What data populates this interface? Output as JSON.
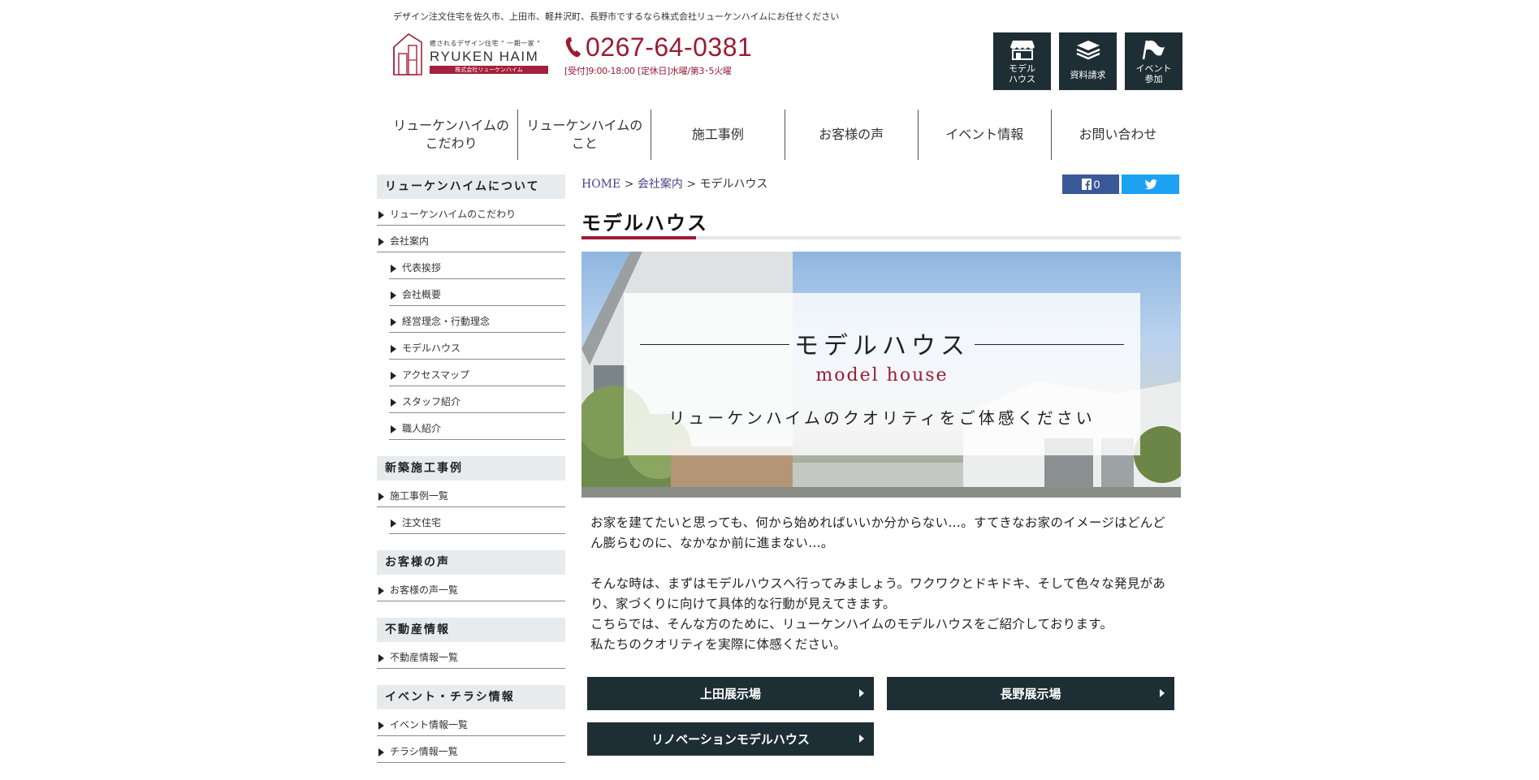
{
  "header": {
    "tagline": "デザイン注文住宅を佐久市、上田市、軽井沢町、長野市でするなら株式会社リューケンハイムにお任せください",
    "logo": {
      "catch": "癒されるデザイン住宅 \" 一期一家 \"",
      "name": "RYUKEN HAIM",
      "company": "株式会社リューケンハイム"
    },
    "phone": "0267-64-0381",
    "hours": "[受付]9:00-18:00 [定休日]水曜/第3･5火曜",
    "buttons": [
      {
        "label1": "モデル",
        "label2": "ハウス",
        "icon": "store-icon"
      },
      {
        "label1": "資料請求",
        "label2": "",
        "icon": "documents-icon"
      },
      {
        "label1": "イベント",
        "label2": "参加",
        "icon": "flag-icon"
      }
    ]
  },
  "nav": [
    {
      "line1": "リューケンハイムの",
      "line2": "こだわり"
    },
    {
      "line1": "リューケンハイムの",
      "line2": "こと"
    },
    {
      "line1": "施工事例",
      "line2": ""
    },
    {
      "line1": "お客様の声",
      "line2": ""
    },
    {
      "line1": "イベント情報",
      "line2": ""
    },
    {
      "line1": "お問い合わせ",
      "line2": ""
    }
  ],
  "sidebar": {
    "about": {
      "heading": "リューケンハイムについて",
      "items": [
        "リューケンハイムのこだわり",
        "会社案内"
      ],
      "sub_items": [
        "代表挨拶",
        "会社概要",
        "経営理念・行動理念",
        "モデルハウス",
        "アクセスマップ",
        "スタッフ紹介",
        "職人紹介"
      ]
    },
    "works": {
      "heading": "新築施工事例",
      "items": [
        "施工事例一覧"
      ],
      "sub_items": [
        "注文住宅"
      ]
    },
    "voice": {
      "heading": "お客様の声",
      "items": [
        "お客様の声一覧"
      ]
    },
    "estate": {
      "heading": "不動産情報",
      "items": [
        "不動産情報一覧"
      ]
    },
    "event": {
      "heading": "イベント・チラシ情報",
      "items": [
        "イベント情報一覧",
        "チラシ情報一覧"
      ]
    }
  },
  "breadcrumb": {
    "home": "HOME",
    "sep": ">",
    "parent": "会社案内",
    "current": "モデルハウス"
  },
  "share": {
    "fb_count": "0"
  },
  "page": {
    "title": "モデルハウス",
    "hero_title": "モデルハウス",
    "hero_sub": "model house",
    "hero_caption": "リューケンハイムのクオリティをご体感ください",
    "paragraphs": [
      "お家を建てたいと思っても、何から始めればいいか分からない…。すてきなお家のイメージはどんどん膨らむのに、なかなか前に進まない…。",
      "そんな時は、まずはモデルハウスへ行ってみましょう。ワクワクとドキドキ、そして色々な発見があり、家づくりに向けて具体的な行動が見えてきます。",
      "こちらでは、そんな方のために、リューケンハイムのモデルハウスをご紹介しております。",
      "私たちのクオリティを実際に体感ください。"
    ],
    "buttons": [
      "上田展示場",
      "長野展示場",
      "リノベーションモデルハウス"
    ]
  },
  "colors": {
    "accent": "#9b1b35",
    "dark": "#1e2e35",
    "sidebar_head": "#e7ebee",
    "facebook": "#3b5998",
    "twitter": "#1da1f2"
  }
}
